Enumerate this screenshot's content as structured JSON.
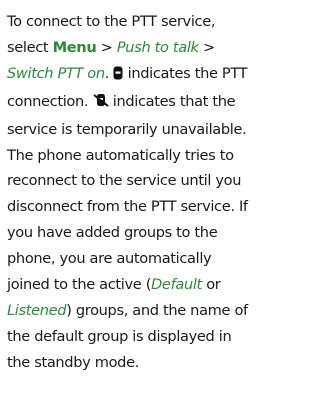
{
  "paragraph": {
    "l1": "To connect to the PTT service,",
    "l2_a": "select ",
    "l2_menu": "Menu",
    "l2_b": " > ",
    "l2_ptt": "Push to talk",
    "l2_c": " >",
    "l3_switch": "Switch PTT on",
    "l3_a": ". ",
    "l3_b": " indicates the PTT",
    "l4_a": "connection. ",
    "l4_b": " indicates that the",
    "l5": "service is temporarily unavailable.",
    "l6": "The phone automatically tries to",
    "l7": "reconnect to the service until you",
    "l8": "disconnect from the PTT service. If",
    "l9": "you have added groups to the",
    "l10": "phone, you are automatically",
    "l11": "joined to the active (",
    "l11_default": "Default",
    "l11_or": " or",
    "l12_listened": "Listened",
    "l12_a": ") groups, and the name of",
    "l13": "the default group is displayed in",
    "l14": "the standby mode."
  },
  "icons": {
    "connected": "ptt-connected-icon",
    "unavailable": "ptt-unavailable-icon"
  },
  "colors": {
    "text": "#1a1a1a",
    "accent": "#2a8a3a"
  }
}
